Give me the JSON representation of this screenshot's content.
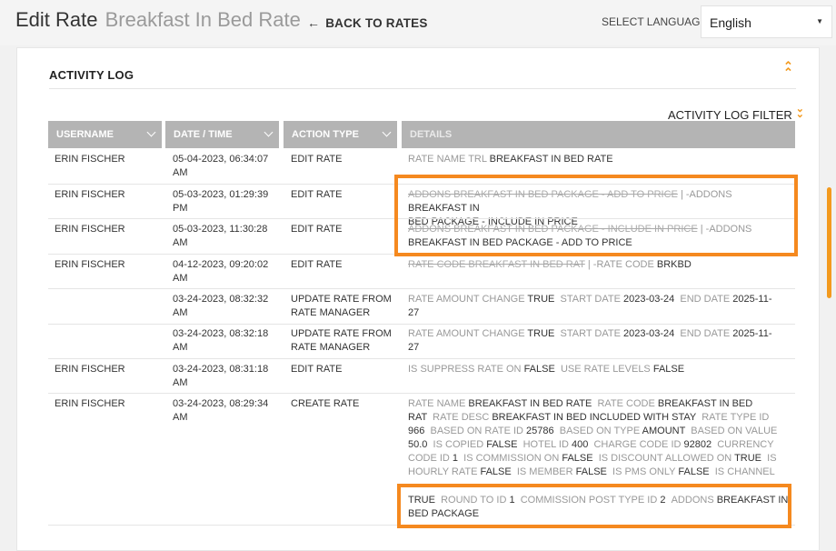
{
  "header": {
    "title": "Edit Rate",
    "subtitle": "Breakfast In Bed Rate",
    "back_label": "BACK TO RATES",
    "language_label": "SELECT LANGUAGE",
    "language_value": "English"
  },
  "activity_log": {
    "title": "ACTIVITY LOG",
    "filter_label": "ACTIVITY LOG FILTER",
    "columns": [
      "USERNAME",
      "DATE / TIME",
      "ACTION TYPE",
      "DETAILS"
    ]
  },
  "rows": [
    {
      "user": "ERIN FISCHER",
      "date1": "05-04-2023, 06:34:07",
      "date2": "AM",
      "action1": "EDIT RATE",
      "action2": "",
      "d": [
        "RATE NAME TRL",
        "BREAKFAST IN BED RATE"
      ]
    },
    {
      "user": "ERIN FISCHER",
      "date1": "05-03-2023, 01:29:39",
      "date2": "PM",
      "action1": "EDIT RATE",
      "action2": "",
      "d": [
        "ADDONS BREAKFAST IN BED PACKAGE - ADD TO PRICE",
        "|",
        "-ADDONS",
        "BREAKFAST IN",
        "BED PACKAGE - INCLUDE IN PRICE"
      ]
    },
    {
      "user": "ERIN FISCHER",
      "date1": "05-03-2023, 11:30:28",
      "date2": "AM",
      "action1": "EDIT RATE",
      "action2": "",
      "d": [
        "ADDONS BREAKFAST IN BED PACKAGE - INCLUDE IN PRICE",
        "|",
        "-ADDONS",
        "BREAKFAST IN BED PACKAGE - ADD TO PRICE"
      ]
    },
    {
      "user": "ERIN FISCHER",
      "date1": "04-12-2023, 09:20:02",
      "date2": "AM",
      "action1": "EDIT RATE",
      "action2": "",
      "d": [
        "RATE CODE BREAKFAST IN BED RAT",
        "|",
        "-RATE CODE",
        "BRKBD"
      ]
    },
    {
      "user": "",
      "date1": "03-24-2023, 08:32:32",
      "date2": "AM",
      "action1": "UPDATE RATE FROM",
      "action2": "RATE MANAGER",
      "d": [
        "RATE AMOUNT CHANGE",
        "TRUE",
        "START DATE",
        "2023-03-24",
        "END DATE",
        "2025-11-",
        "27"
      ]
    },
    {
      "user": "",
      "date1": "03-24-2023, 08:32:18",
      "date2": "AM",
      "action1": "UPDATE RATE FROM",
      "action2": "RATE MANAGER",
      "d": [
        "RATE AMOUNT CHANGE",
        "TRUE",
        "START DATE",
        "2023-03-24",
        "END DATE",
        "2025-11-",
        "27"
      ]
    },
    {
      "user": "ERIN FISCHER",
      "date1": "03-24-2023, 08:31:18",
      "date2": "AM",
      "action1": "EDIT RATE",
      "action2": "",
      "d": [
        "IS SUPPRESS RATE ON",
        "FALSE",
        "USE RATE LEVELS",
        "FALSE"
      ]
    },
    {
      "user": "ERIN FISCHER",
      "date1": "03-24-2023, 08:29:34",
      "date2": "AM",
      "action1": "CREATE RATE",
      "action2": "",
      "d": [
        "RATE NAME",
        "BREAKFAST IN BED RATE",
        "RATE CODE",
        "BREAKFAST IN BED",
        "RAT",
        "RATE DESC",
        "BREAKFAST IN BED INCLUDED WITH STAY",
        "RATE TYPE ID",
        "966",
        "BASED ON RATE ID",
        "25786",
        "BASED ON TYPE",
        "AMOUNT",
        "BASED ON VALUE",
        "50.0",
        "IS COPIED",
        "FALSE",
        "HOTEL ID",
        "400",
        "CHARGE CODE ID",
        "92802",
        "CURRENCY",
        "CODE ID",
        "1",
        "IS COMMISSION ON",
        "FALSE",
        "IS DISCOUNT ALLOWED ON",
        "TRUE",
        "IS",
        "HOURLY RATE",
        "FALSE",
        "IS MEMBER",
        "FALSE",
        "IS PMS ONLY",
        "FALSE",
        "IS CHANNEL",
        "TRUE",
        "ROUND TO ID",
        "1",
        "COMMISSION POST TYPE ID",
        "2",
        "ADDONS",
        "BREAKFAST IN",
        "BED PACKAGE"
      ]
    }
  ],
  "colors": {
    "accent": "#f39a1e",
    "highlight": "#f5891f",
    "header_bg": "#b4b4b4"
  },
  "icons": [
    "left-arrow-icon",
    "caret-down-icon",
    "chevron-double-up-icon",
    "chevron-double-down-icon",
    "sort-chevron-icon"
  ]
}
